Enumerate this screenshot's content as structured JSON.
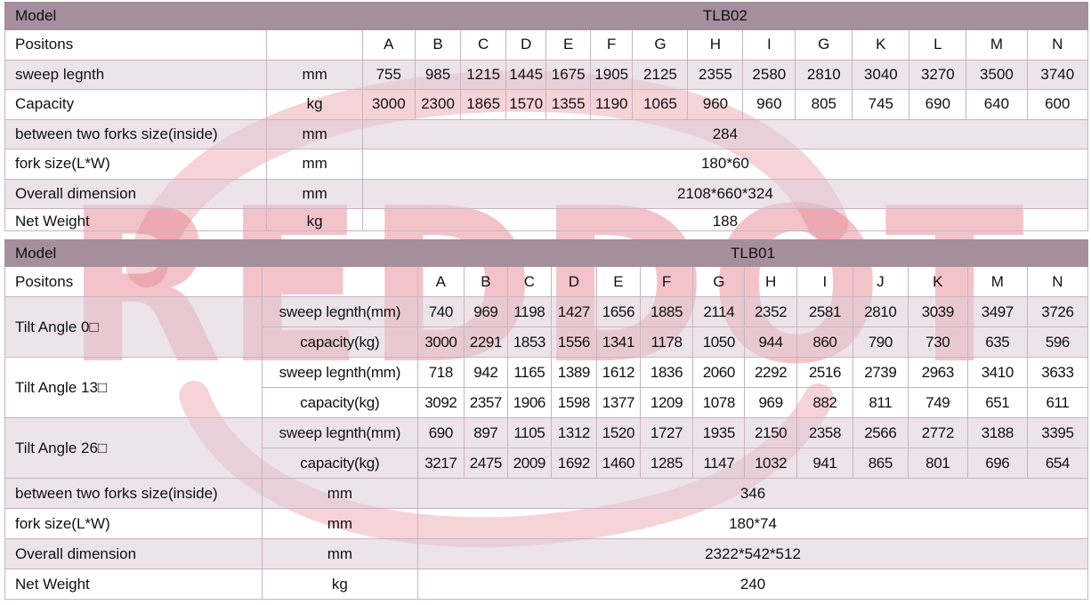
{
  "watermark": {
    "text": "REDDOT",
    "color": "#e06a78"
  },
  "tlb02": {
    "model_label": "Model",
    "model": "TLB02",
    "positions_label": "Positons",
    "positions": [
      "A",
      "B",
      "C",
      "D",
      "E",
      "F",
      "G",
      "H",
      "I",
      "G",
      "K",
      "L",
      "M",
      "N"
    ],
    "sweep": {
      "label": "sweep legnth",
      "unit": "mm",
      "values": [
        "755",
        "985",
        "1215",
        "1445",
        "1675",
        "1905",
        "2125",
        "2355",
        "2580",
        "2810",
        "3040",
        "3270",
        "3500",
        "3740"
      ]
    },
    "capacity": {
      "label": "Capacity",
      "unit": "kg",
      "values": [
        "3000",
        "2300",
        "1865",
        "1570",
        "1355",
        "1190",
        "1065",
        "960",
        "960",
        "805",
        "745",
        "690",
        "640",
        "600"
      ]
    },
    "between": {
      "label": "between two forks size(inside)",
      "unit": "mm",
      "value": "284"
    },
    "fork": {
      "label": "fork size(L*W)",
      "unit": "mm",
      "value": "180*60"
    },
    "overall": {
      "label": "Overall dimension",
      "unit": "mm",
      "value": "2108*660*324"
    },
    "net": {
      "label": "Net Weight",
      "unit": "kg",
      "value": "188"
    }
  },
  "tlb01": {
    "model_label": "Model",
    "model": "TLB01",
    "positions_label": "Positons",
    "positions": [
      "A",
      "B",
      "C",
      "D",
      "E",
      "F",
      "G",
      "H",
      "I",
      "J",
      "K",
      "M",
      "N"
    ],
    "sweep_label": "sweep legnth(mm)",
    "capacity_label": "capacity(kg)",
    "tilts": [
      {
        "label": "Tilt Angle 0□",
        "sweep": [
          "740",
          "969",
          "1198",
          "1427",
          "1656",
          "1885",
          "2114",
          "2352",
          "2581",
          "2810",
          "3039",
          "3497",
          "3726"
        ],
        "capacity": [
          "3000",
          "2291",
          "1853",
          "1556",
          "1341",
          "1178",
          "1050",
          "944",
          "860",
          "790",
          "730",
          "635",
          "596"
        ]
      },
      {
        "label": "Tilt Angle 13□",
        "sweep": [
          "718",
          "942",
          "1165",
          "1389",
          "1612",
          "1836",
          "2060",
          "2292",
          "2516",
          "2739",
          "2963",
          "3410",
          "3633"
        ],
        "capacity": [
          "3092",
          "2357",
          "1906",
          "1598",
          "1377",
          "1209",
          "1078",
          "969",
          "882",
          "811",
          "749",
          "651",
          "611"
        ]
      },
      {
        "label": "Tilt Angle 26□",
        "sweep": [
          "690",
          "897",
          "1105",
          "1312",
          "1520",
          "1727",
          "1935",
          "2150",
          "2358",
          "2566",
          "2772",
          "3188",
          "3395"
        ],
        "capacity": [
          "3217",
          "2475",
          "2009",
          "1692",
          "1460",
          "1285",
          "1147",
          "1032",
          "941",
          "865",
          "801",
          "696",
          "654"
        ]
      }
    ],
    "between": {
      "label": "between two forks size(inside)",
      "unit": "mm",
      "value": "346"
    },
    "fork": {
      "label": "fork size(L*W)",
      "unit": "mm",
      "value": "180*74"
    },
    "overall": {
      "label": "Overall dimension",
      "unit": "mm",
      "value": "2322*542*512"
    },
    "net": {
      "label": "Net Weight",
      "unit": "kg",
      "value": "240"
    }
  }
}
